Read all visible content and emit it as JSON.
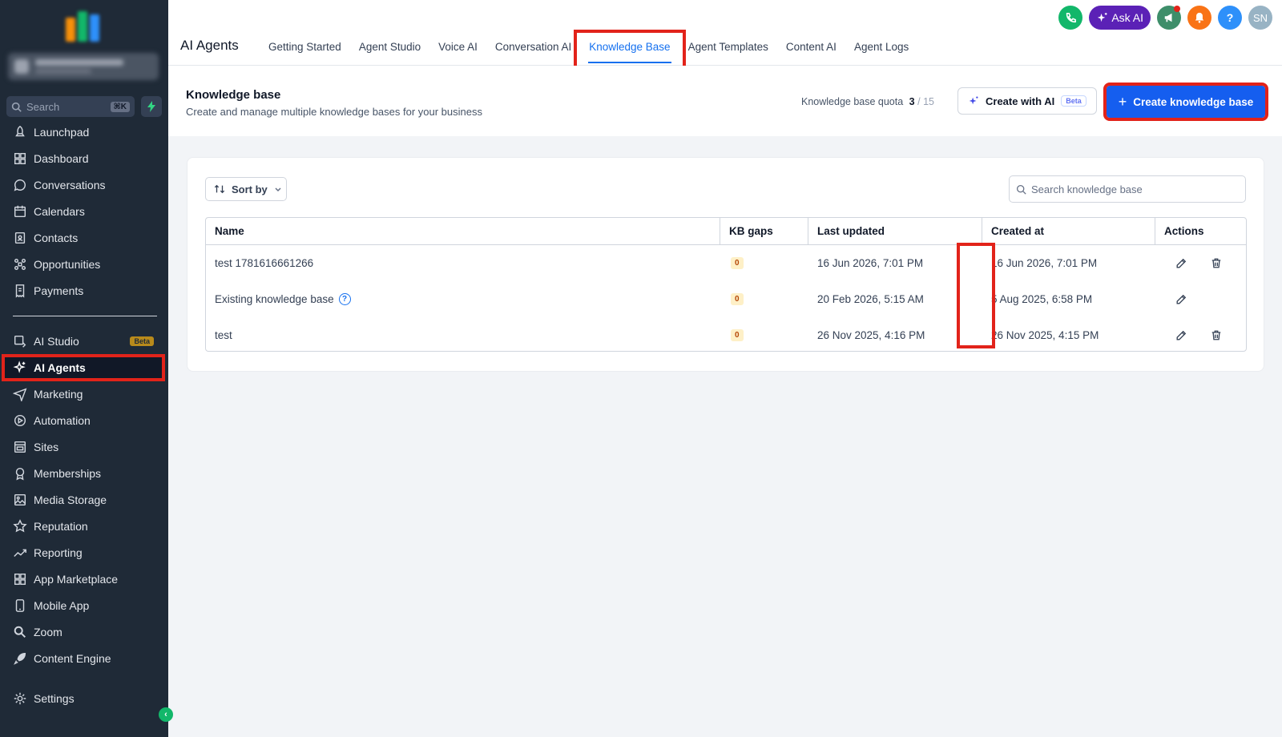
{
  "sidebar": {
    "search_placeholder": "Search",
    "search_shortcut": "⌘K",
    "items": [
      {
        "label": "Launchpad",
        "icon": "rocket-icon"
      },
      {
        "label": "Dashboard",
        "icon": "dashboard-icon"
      },
      {
        "label": "Conversations",
        "icon": "chat-icon"
      },
      {
        "label": "Calendars",
        "icon": "calendar-icon"
      },
      {
        "label": "Contacts",
        "icon": "contacts-icon"
      },
      {
        "label": "Opportunities",
        "icon": "opportunities-icon"
      },
      {
        "label": "Payments",
        "icon": "receipt-icon"
      },
      {
        "label": "AI Studio",
        "icon": "ai-studio-icon",
        "badge": "Beta"
      },
      {
        "label": "AI Agents",
        "icon": "sparkle-icon",
        "active": true
      },
      {
        "label": "Marketing",
        "icon": "send-icon"
      },
      {
        "label": "Automation",
        "icon": "automation-icon"
      },
      {
        "label": "Sites",
        "icon": "sites-icon"
      },
      {
        "label": "Memberships",
        "icon": "award-icon"
      },
      {
        "label": "Media Storage",
        "icon": "image-icon"
      },
      {
        "label": "Reputation",
        "icon": "star-icon"
      },
      {
        "label": "Reporting",
        "icon": "trend-icon"
      },
      {
        "label": "App Marketplace",
        "icon": "grid-icon"
      },
      {
        "label": "Mobile App",
        "icon": "phone-icon"
      },
      {
        "label": "Zoom",
        "icon": "zoom-icon"
      },
      {
        "label": "Content Engine",
        "icon": "rocket-icon"
      },
      {
        "label": "Settings",
        "icon": "gear-icon"
      }
    ]
  },
  "topbar": {
    "title": "AI Agents",
    "tabs": [
      {
        "label": "Getting Started"
      },
      {
        "label": "Agent Studio"
      },
      {
        "label": "Voice AI"
      },
      {
        "label": "Conversation AI"
      },
      {
        "label": "Knowledge Base",
        "active": true
      },
      {
        "label": "Agent Templates"
      },
      {
        "label": "Content AI"
      },
      {
        "label": "Agent Logs"
      }
    ],
    "ask_ai_label": "Ask AI",
    "help_label": "?",
    "avatar_initials": "SN"
  },
  "header": {
    "title": "Knowledge base",
    "subtitle": "Create and manage multiple knowledge bases for your business",
    "quota_label": "Knowledge base quota",
    "quota_used": "3",
    "quota_sep": "/",
    "quota_total": "15",
    "create_ai_label": "Create with AI",
    "create_ai_badge": "Beta",
    "create_kb_label": "Create knowledge base"
  },
  "toolbar": {
    "sort_label": "Sort by",
    "search_placeholder": "Search knowledge base"
  },
  "table": {
    "columns": [
      "Name",
      "KB gaps",
      "Last updated",
      "Created at",
      "Actions"
    ],
    "rows": [
      {
        "name": "test 1781616661266",
        "kb_gaps": "0",
        "last_updated": "16 Jun 2026, 7:01 PM",
        "created_at": "16 Jun 2026, 7:01 PM",
        "info": false,
        "deletable": true
      },
      {
        "name": "Existing knowledge base",
        "kb_gaps": "0",
        "last_updated": "20 Feb 2026, 5:15 AM",
        "created_at": "5 Aug 2025, 6:58 PM",
        "info": true,
        "deletable": false
      },
      {
        "name": "test",
        "kb_gaps": "0",
        "last_updated": "26 Nov 2025, 4:16 PM",
        "created_at": "26 Nov 2025, 4:15 PM",
        "info": false,
        "deletable": true
      }
    ]
  },
  "colors": {
    "sidebar_bg": "#1f2a37",
    "primary": "#155eef",
    "highlight": "#e2231a",
    "phone": "#12b76a",
    "ask_ai": "#5b21b6",
    "announce": "#3e8e6a",
    "bell": "#f97316",
    "help": "#2e90fa",
    "avatar": "#98b3c4"
  }
}
